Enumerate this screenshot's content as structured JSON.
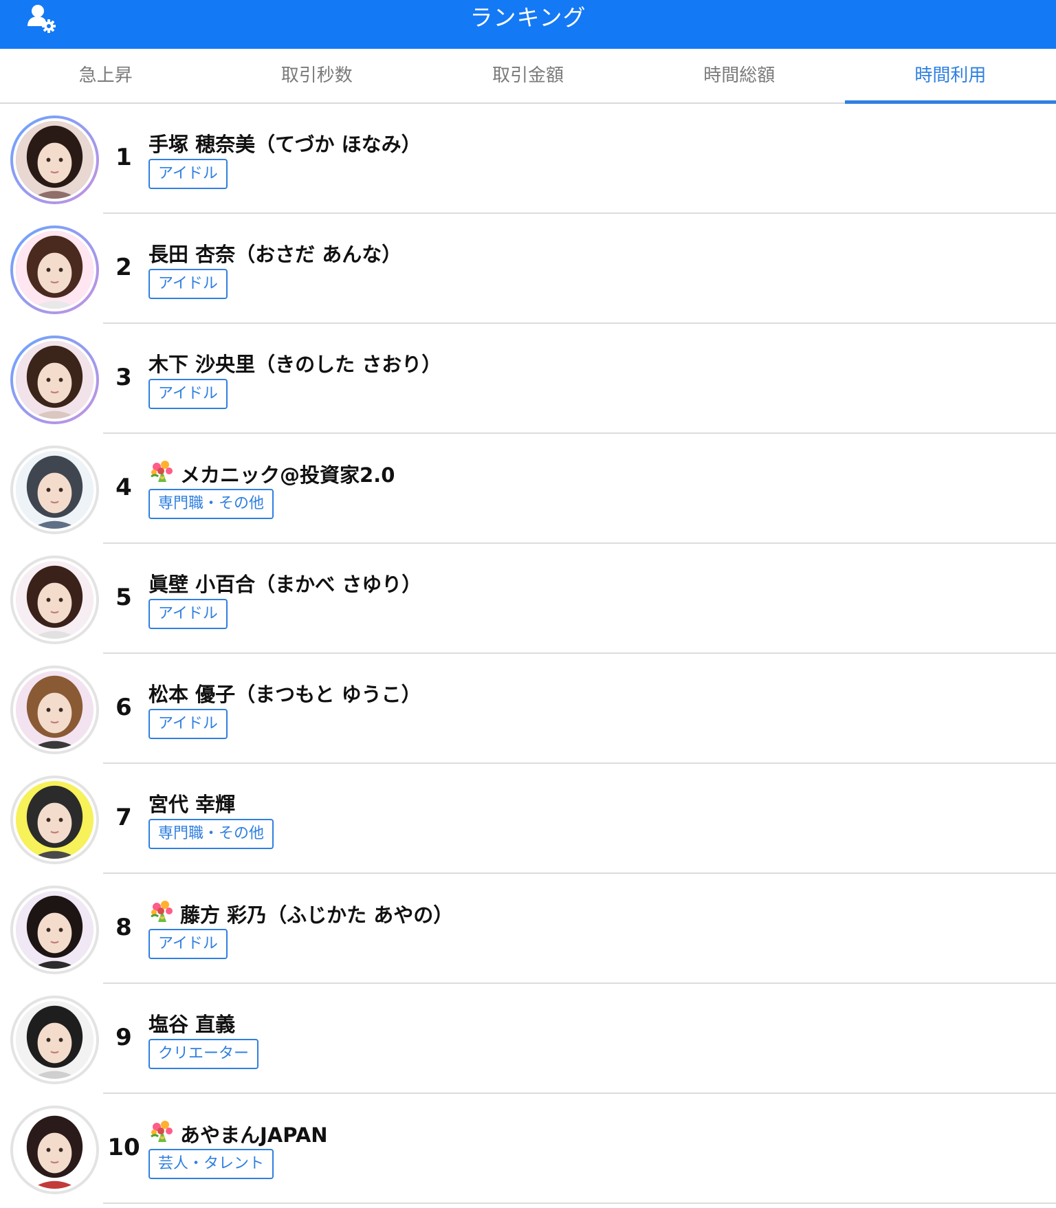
{
  "header": {
    "title": "ランキング",
    "settings_icon": "user-settings-icon"
  },
  "tabs": [
    {
      "label": "急上昇",
      "active": false
    },
    {
      "label": "取引秒数",
      "active": false
    },
    {
      "label": "取引金額",
      "active": false
    },
    {
      "label": "時間総額",
      "active": false
    },
    {
      "label": "時間利用",
      "active": true
    }
  ],
  "colors": {
    "accent": "#1479f5",
    "tab_active": "#2f7fe0",
    "tag": "#2f7fe0"
  },
  "ranking": [
    {
      "rank": "1",
      "name": "手塚 穂奈美（てづか ほなみ）",
      "tag": "アイドル",
      "flower": false
    },
    {
      "rank": "2",
      "name": "長田 杏奈（おさだ あんな）",
      "tag": "アイドル",
      "flower": false
    },
    {
      "rank": "3",
      "name": "木下 沙央里（きのした さおり）",
      "tag": "アイドル",
      "flower": false
    },
    {
      "rank": "4",
      "name": "メカニック@投資家2.0",
      "tag": "専門職・その他",
      "flower": true
    },
    {
      "rank": "5",
      "name": "眞壁 小百合（まかべ さゆり）",
      "tag": "アイドル",
      "flower": false
    },
    {
      "rank": "6",
      "name": "松本 優子（まつもと ゆうこ）",
      "tag": "アイドル",
      "flower": false
    },
    {
      "rank": "7",
      "name": "宮代 幸輝",
      "tag": "専門職・その他",
      "flower": false
    },
    {
      "rank": "8",
      "name": "藤方 彩乃（ふじかた あやの）",
      "tag": "アイドル",
      "flower": true
    },
    {
      "rank": "9",
      "name": "塩谷 直義",
      "tag": "クリエーター",
      "flower": false
    },
    {
      "rank": "10",
      "name": "あやまんJAPAN",
      "tag": "芸人・タレント",
      "flower": true
    }
  ]
}
